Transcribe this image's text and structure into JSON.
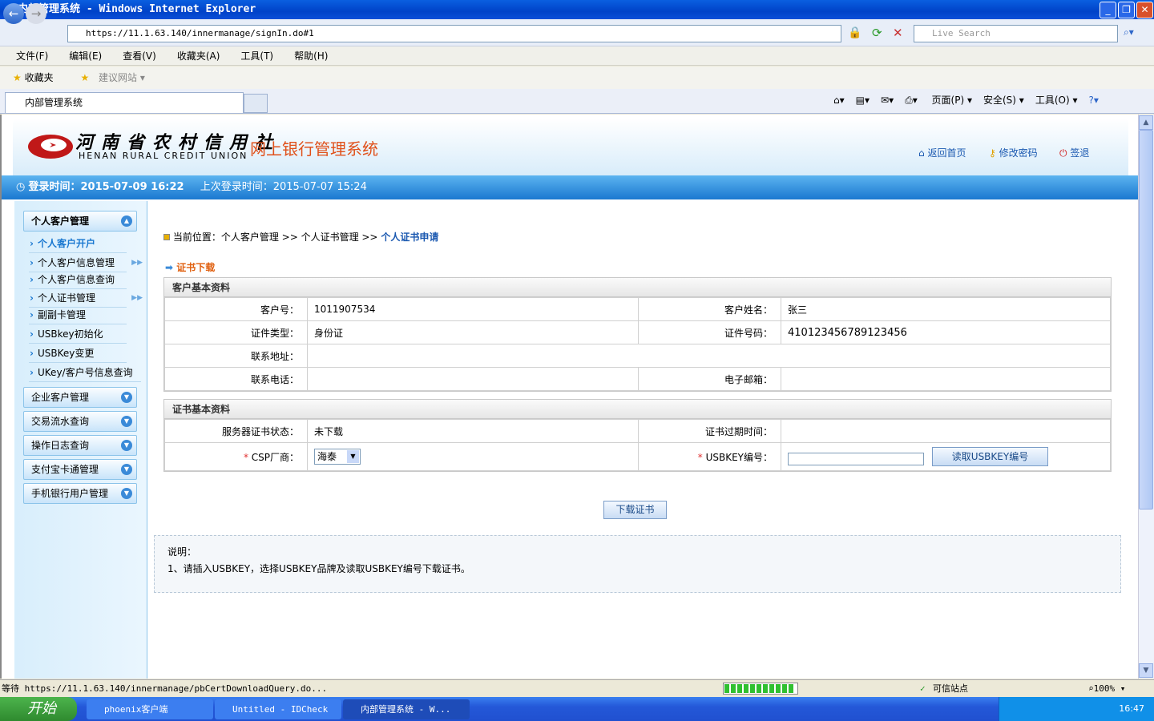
{
  "window": {
    "title": "内部管理系统 - Windows Internet Explorer"
  },
  "browser": {
    "url": "https://11.1.63.140/innermanage/signIn.do#1",
    "search_placeholder": "Live Search",
    "menu": [
      "文件(F)",
      "编辑(E)",
      "查看(V)",
      "收藏夹(A)",
      "工具(T)",
      "帮助(H)"
    ],
    "favorites": "收藏夹",
    "suggested": "建议网站 ▾",
    "tab": "内部管理系统",
    "toolbar": [
      "页面(P) ▾",
      "安全(S) ▾",
      "工具(O) ▾"
    ],
    "status_text": "等待 https://11.1.63.140/innermanage/pbCertDownloadQuery.do...",
    "zone": "可信站点",
    "zoom": "100%",
    "progress": 0.95
  },
  "header": {
    "logo_cn": "河南省农村信用社",
    "logo_en": "HENAN RURAL CREDIT UNION",
    "system_title": "网上银行管理系统",
    "links": [
      "返回首页",
      "修改密码",
      "签退"
    ],
    "login_time": "登录时间：2015-07-09 16:22",
    "last_login": "上次登录时间：2015-07-07 15:24"
  },
  "sidebar": {
    "groups": [
      "个人客户管理",
      "企业客户管理",
      "交易流水查询",
      "操作日志查询",
      "支付宝卡通管理",
      "手机银行用户管理"
    ],
    "items": [
      "个人客户开户",
      "个人客户信息管理",
      "个人客户信息查询",
      "个人证书管理",
      "副副卡管理",
      "USBkey初始化",
      "USBKey变更",
      "UKey/客户号信息查询"
    ]
  },
  "breadcrumb": {
    "prefix": "当前位置：个人客户管理  >> 个人证书管理  >> ",
    "current": "个人证书申请"
  },
  "section_title": "证书下载",
  "customer": {
    "title": "客户基本资料",
    "labels": [
      "客户号：",
      "客户姓名：",
      "证件类型：",
      "证件号码：",
      "联系地址：",
      "联系电话：",
      "电子邮箱："
    ],
    "customer_no": "1011907534",
    "name": "张三",
    "id_type": "身份证",
    "id_no": "410123456789123456"
  },
  "cert": {
    "title": "证书基本资料",
    "labels": [
      "服务器证书状态：",
      "证书过期时间：",
      "CSP厂商：",
      "USBKEY编号："
    ],
    "status": "未下载",
    "csp": "海泰",
    "read_button": "读取USBKEY编号",
    "required": "*"
  },
  "download_button": "下载证书",
  "note": {
    "title": "说明：",
    "line1": "1、请插入USBKEY，选择USBKEY品牌及读取USBKEY编号下载证书。"
  },
  "taskbar": {
    "start": "开始",
    "tasks": [
      "phoenix客户端",
      "Untitled - IDCheck",
      "内部管理系统 - W..."
    ],
    "clock": "16:47"
  }
}
